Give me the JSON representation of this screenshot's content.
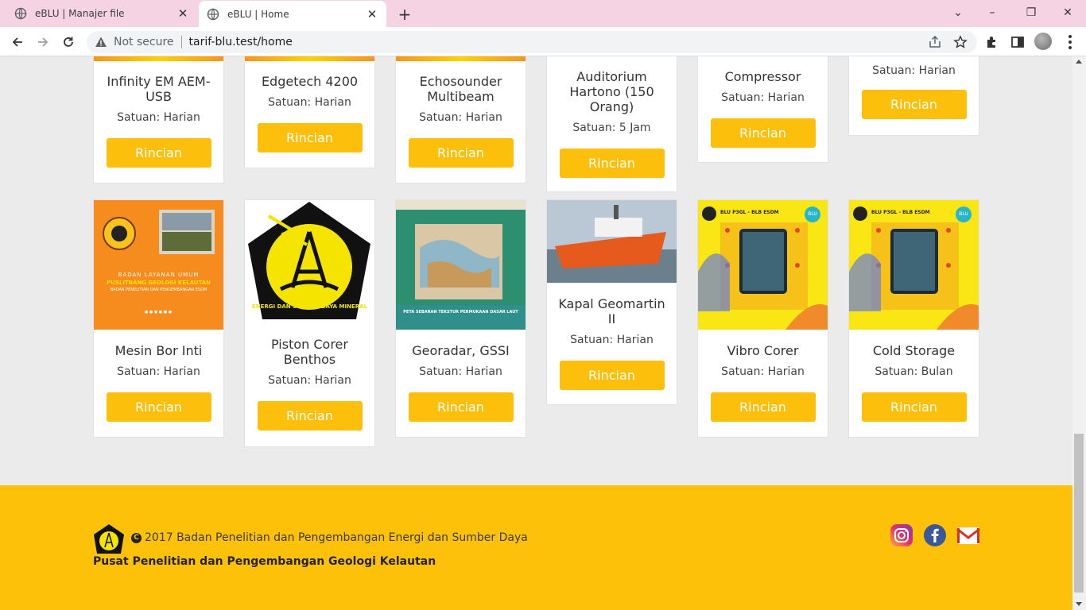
{
  "browser": {
    "tabs": [
      {
        "title": "eBLU | Manajer file",
        "active": false
      },
      {
        "title": "eBLU | Home",
        "active": true
      }
    ],
    "security_label": "Not secure",
    "url": "tarif-blu.test/home"
  },
  "rows": {
    "top": [
      {
        "name": "Infinity EM AEM-USB",
        "unit": "Satuan: Harian",
        "button": "Rincian"
      },
      {
        "name": "Edgetech 4200",
        "unit": "Satuan: Harian",
        "button": "Rincian"
      },
      {
        "name": "Echosounder Multibeam",
        "unit": "Satuan: Harian",
        "button": "Rincian"
      },
      {
        "name": "Auditorium Hartono (150 Orang)",
        "unit": "Satuan: 5 Jam",
        "button": "Rincian"
      },
      {
        "name": "Compressor",
        "unit": "Satuan: Harian",
        "button": "Rincian"
      },
      {
        "name": "",
        "unit": "Satuan: Harian",
        "button": "Rincian"
      }
    ],
    "bottom": [
      {
        "name": "Mesin Bor Inti",
        "unit": "Satuan: Harian",
        "button": "Rincian"
      },
      {
        "name": "Piston Corer Benthos",
        "unit": "Satuan: Harian",
        "button": "Rincian"
      },
      {
        "name": "Georadar, GSSI",
        "unit": "Satuan: Harian",
        "button": "Rincian"
      },
      {
        "name": "Kapal Geomartin II",
        "unit": "Satuan: Harian",
        "button": "Rincian"
      },
      {
        "name": "Vibro Corer",
        "unit": "Satuan: Harian",
        "button": "Rincian"
      },
      {
        "name": "Cold Storage",
        "unit": "Satuan: Bulan",
        "button": "Rincian"
      }
    ]
  },
  "images": {
    "mesin_bor": {
      "line1": "BADAN LAYANAN UMUM",
      "line2": "PUSLITBANG GEOLOGI KELAUTAN",
      "line3": "BADAN PENELITIAN DAN PENGEMBANGAN ESDM"
    },
    "piston_logo_text": "ENERGI DAN SUMBER DAYA MINERAL",
    "georadar_title": "PETA SEBARAN TEKSTUR PERMUKAAN DASAR LAUT",
    "blu_header": "BLU P3GL - BLB ESDM",
    "blu_badge": "BLU"
  },
  "footer": {
    "copyright": "2017 Badan Penelitian dan Pengembangan Energi dan Sumber Daya",
    "copyright_symbol": "C",
    "org": "Pusat Penelitian dan Pengembangan Geologi Kelautan",
    "social": [
      "instagram-icon",
      "facebook-icon",
      "gmail-icon"
    ]
  },
  "colors": {
    "accent": "#fbbf0c",
    "footer_bg": "#fdc10a",
    "tabbar_bg": "#f6d3e2",
    "page_bg": "#ebebeb"
  }
}
